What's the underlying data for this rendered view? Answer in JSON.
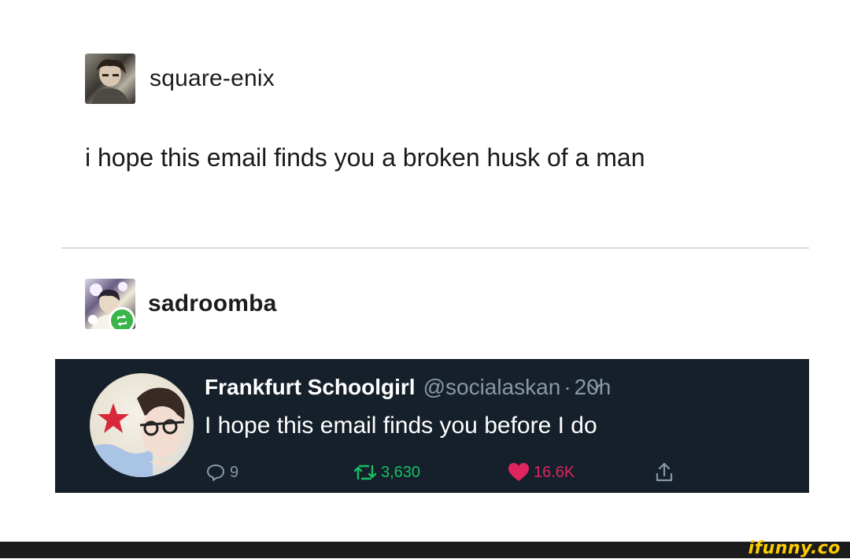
{
  "posts": [
    {
      "blog_name": "square-enix",
      "avatar_icon": "avatar-square-enix",
      "body": "i hope this email finds you a broken husk of a man"
    },
    {
      "blog_name": "sadroomba",
      "avatar_icon": "avatar-sadroomba",
      "badge_icon": "reblog-icon"
    }
  ],
  "tweet": {
    "display_name": "Frankfurt Schoolgirl",
    "handle": "@socialaskan",
    "separator": "·",
    "time": "20h",
    "text": "I hope this email finds you before I do",
    "replies": "9",
    "retweets": "3,630",
    "likes": "16.6K",
    "menu_icon": "chevron-down-icon",
    "share_icon": "share-icon"
  },
  "footer": {
    "watermark": "ifunny.co"
  },
  "colors": {
    "tweet_background": "#15202b",
    "reblog_badge": "#39b54a",
    "retweet_green": "#17bf63",
    "like_red": "#e0245e",
    "muted_gray": "#8899a6",
    "watermark_yellow": "#ffcc00"
  }
}
